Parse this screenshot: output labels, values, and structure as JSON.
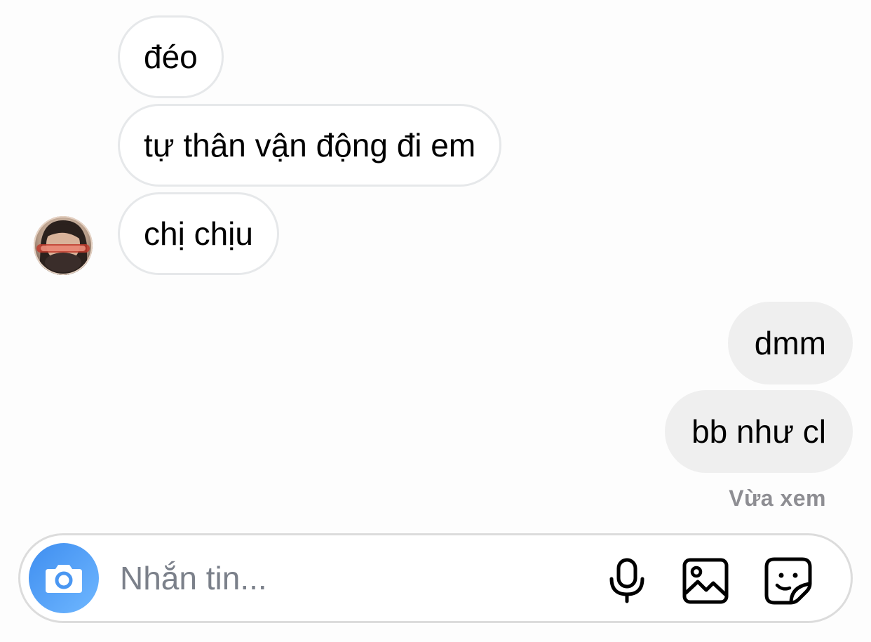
{
  "messages": {
    "incoming": [
      {
        "text": "đéo"
      },
      {
        "text": "tự thân vận động đi em"
      },
      {
        "text": "chị chịu"
      }
    ],
    "outgoing": [
      {
        "text": "dmm"
      },
      {
        "text": "bb như cl"
      }
    ]
  },
  "status": {
    "seen_label": "Vừa xem"
  },
  "composer": {
    "placeholder": "Nhắn tin...",
    "value": ""
  },
  "icons": {
    "camera": "camera-icon",
    "microphone": "microphone-icon",
    "gallery": "image-gallery-icon",
    "sticker": "sticker-icon"
  },
  "colors": {
    "camera_button": "#3f8ef0",
    "incoming_bubble_border": "#e6e8ea",
    "outgoing_bubble": "#efefef",
    "seen_text": "#8e8e93",
    "placeholder": "#7b808a"
  }
}
